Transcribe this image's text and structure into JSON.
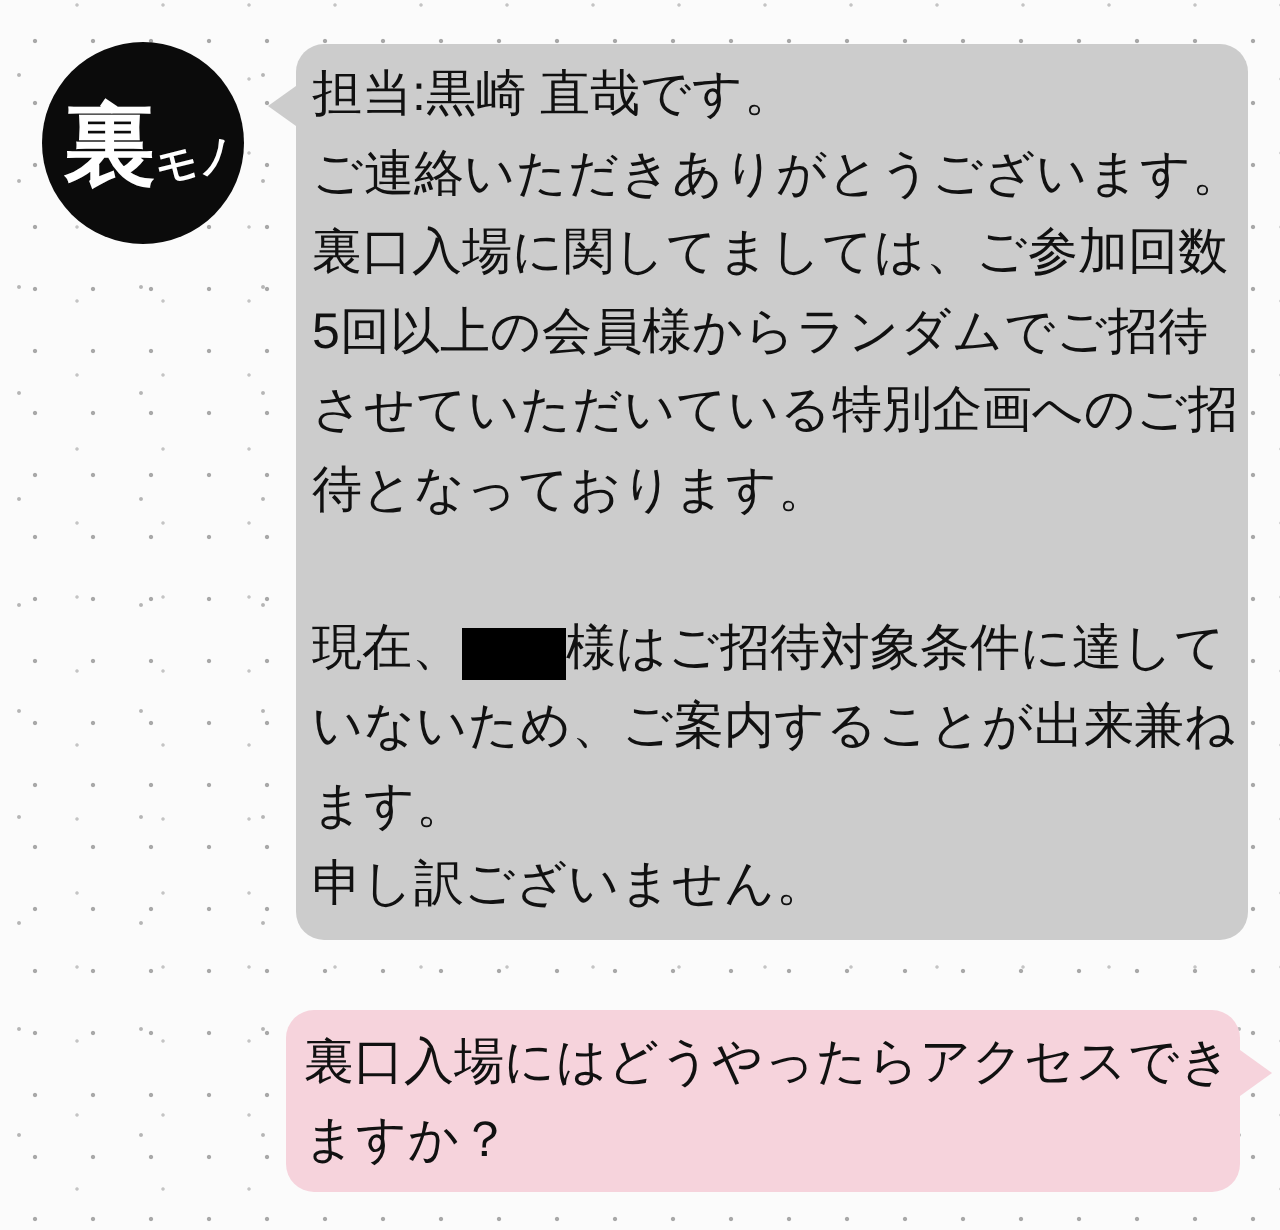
{
  "chat": {
    "messages": [
      {
        "kind": "received",
        "avatar": {
          "logo_main": "裏",
          "logo_sub": "モノ"
        },
        "sections": [
          [
            {
              "kind": "text",
              "text": "担当:黒崎 直哉です。"
            },
            {
              "kind": "text",
              "text": "ご連絡いただきありがとうございます。"
            },
            {
              "kind": "text",
              "text": "裏口入場に関してましては、ご参加回数5回以上の会員様からランダムでご招待させていただいている特別企画へのご招待となっております。"
            }
          ],
          [
            {
              "kind": "redacted",
              "before": "現在、",
              "after": "様はご招待対象条件に達していないため、ご案内することが出来兼ねます。"
            },
            {
              "kind": "text",
              "text": "申し訳ございません。"
            }
          ]
        ]
      },
      {
        "kind": "sent",
        "sections": [
          [
            {
              "kind": "text",
              "text": "裏口入場にはどうやったらアクセスできますか？"
            }
          ]
        ]
      }
    ]
  }
}
